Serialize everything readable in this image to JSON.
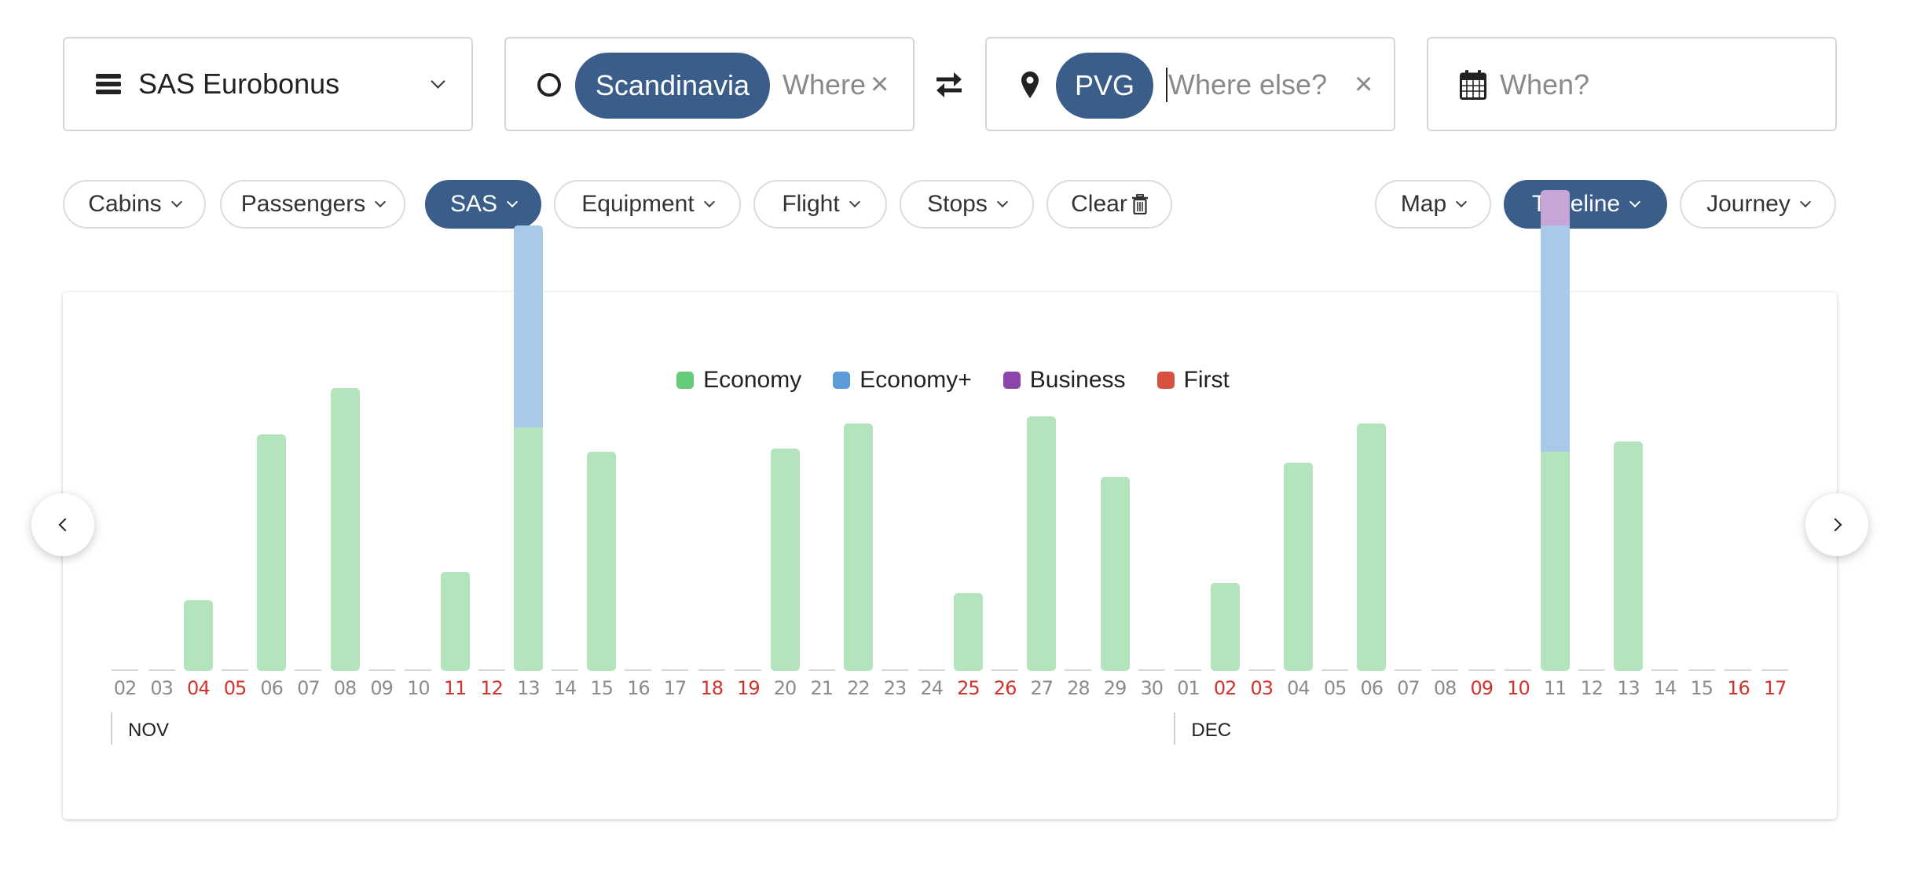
{
  "program_selector": {
    "value": "SAS Eurobonus",
    "icon": "menu-icon"
  },
  "origin": {
    "chip": "Scandinavia",
    "placeholder": "Where",
    "clear_icon": "×",
    "icon": "circle-icon"
  },
  "swap_icon": "⇄",
  "destination": {
    "chip": "PVG",
    "placeholder": "Where else?",
    "clear_icon": "×",
    "icon": "map-pin-icon"
  },
  "date": {
    "placeholder": "When?",
    "icon": "calendar-icon"
  },
  "filters": [
    {
      "label": "Cabins",
      "active": false
    },
    {
      "label": "Passengers",
      "active": false
    },
    {
      "label": "SAS",
      "active": true
    },
    {
      "label": "Equipment",
      "active": false
    },
    {
      "label": "Flight",
      "active": false
    },
    {
      "label": "Stops",
      "active": false
    }
  ],
  "clear_button": {
    "label": "Clear",
    "icon": "trash-icon"
  },
  "views": [
    {
      "label": "Map",
      "active": false
    },
    {
      "label": "Timeline",
      "active": true
    },
    {
      "label": "Journey",
      "active": false
    }
  ],
  "colors": {
    "accent": "#3a5d89",
    "weekend_label": "#d0342c",
    "weekday_label": "#8c8c8c"
  },
  "nav": {
    "prev_icon": "chevron-left-icon",
    "next_icon": "chevron-right-icon"
  },
  "chart_data": {
    "type": "bar",
    "stacked": true,
    "title": "",
    "xlabel": "",
    "ylabel": "",
    "legend": {
      "placement": "top-center"
    },
    "series_meta": [
      {
        "name": "Economy",
        "legend_color": "#66cc7a",
        "bar_color": "#b3e4bd"
      },
      {
        "name": "Economy+",
        "legend_color": "#5a9bd8",
        "bar_color": "#a9c9ea"
      },
      {
        "name": "Business",
        "legend_color": "#8e44ad",
        "bar_color": "#c6a6d6"
      },
      {
        "name": "First",
        "legend_color": "#d95140",
        "bar_color": "#eaa89f"
      }
    ],
    "months": [
      {
        "label": "NOV",
        "start_index": 0
      },
      {
        "label": "DEC",
        "start_index": 29
      }
    ],
    "categories": [
      "02",
      "03",
      "04",
      "05",
      "06",
      "07",
      "08",
      "09",
      "10",
      "11",
      "12",
      "13",
      "14",
      "15",
      "16",
      "17",
      "18",
      "19",
      "20",
      "21",
      "22",
      "23",
      "24",
      "25",
      "26",
      "27",
      "28",
      "29",
      "30",
      "01",
      "02",
      "03",
      "04",
      "05",
      "06",
      "07",
      "08",
      "09",
      "10",
      "11",
      "12",
      "13",
      "14",
      "15",
      "16",
      "17"
    ],
    "weekend": [
      false,
      false,
      true,
      true,
      false,
      false,
      false,
      false,
      false,
      true,
      true,
      false,
      false,
      false,
      false,
      false,
      true,
      true,
      false,
      false,
      false,
      false,
      false,
      true,
      true,
      false,
      false,
      false,
      false,
      false,
      true,
      true,
      false,
      false,
      false,
      false,
      false,
      true,
      true,
      false,
      false,
      false,
      false,
      false,
      true,
      true
    ],
    "series": [
      {
        "name": "Economy",
        "values": [
          0,
          0,
          2.0,
          0,
          6.7,
          0,
          8.0,
          0,
          0,
          2.8,
          0,
          6.9,
          0,
          6.2,
          0,
          0,
          0,
          0,
          6.3,
          0,
          7.0,
          0,
          0,
          2.2,
          0,
          7.2,
          0,
          5.5,
          0,
          0,
          2.5,
          0,
          5.9,
          0,
          7.0,
          0,
          0,
          0,
          0,
          6.2,
          0,
          6.5,
          0,
          0,
          0,
          0
        ]
      },
      {
        "name": "Economy+",
        "values": [
          0,
          0,
          0,
          0,
          0,
          0,
          0,
          0,
          0,
          0,
          0,
          5.7,
          0,
          0,
          0,
          0,
          0,
          0,
          0,
          0,
          0,
          0,
          0,
          0,
          0,
          0,
          0,
          0,
          0,
          0,
          0,
          0,
          0,
          0,
          0,
          0,
          0,
          0,
          0,
          6.4,
          0,
          0,
          0,
          0,
          0,
          0
        ]
      },
      {
        "name": "Business",
        "values": [
          0,
          0,
          0,
          0,
          0,
          0,
          0,
          0,
          0,
          0,
          0,
          0,
          0,
          0,
          0,
          0,
          0,
          0,
          0,
          0,
          0,
          0,
          0,
          0,
          0,
          0,
          0,
          0,
          0,
          0,
          0,
          0,
          0,
          0,
          0,
          0,
          0,
          0,
          0,
          1.0,
          0,
          0,
          0,
          0,
          0,
          0
        ]
      },
      {
        "name": "First",
        "values": [
          0,
          0,
          0,
          0,
          0,
          0,
          0,
          0,
          0,
          0,
          0,
          0,
          0,
          0,
          0,
          0,
          0,
          0,
          0,
          0,
          0,
          0,
          0,
          0,
          0,
          0,
          0,
          0,
          0,
          0,
          0,
          0,
          0,
          0,
          0,
          0,
          0,
          0,
          0,
          0,
          0,
          0,
          0,
          0,
          0,
          0
        ]
      }
    ],
    "ylim": [
      0,
      14
    ],
    "grid": false
  }
}
